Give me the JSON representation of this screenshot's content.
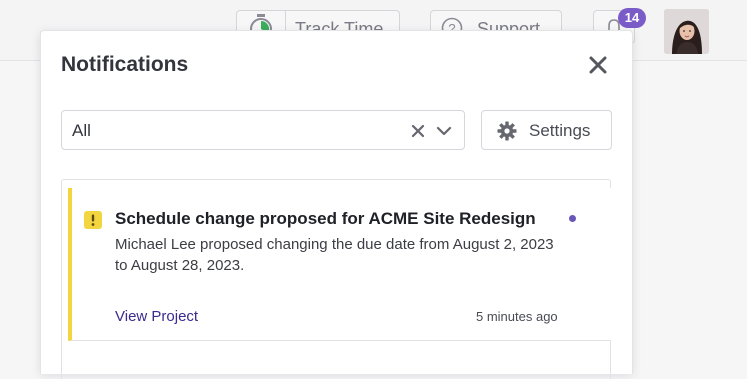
{
  "topbar": {
    "track_time_label": "Track Time",
    "support_label": "Support",
    "notification_count": "14",
    "badge_color": "#7a5bc8"
  },
  "panel": {
    "title": "Notifications",
    "filter": {
      "value": "All"
    },
    "settings_label": "Settings"
  },
  "notifications": [
    {
      "title": "Schedule change proposed for ACME Site Redesign",
      "body": "Michael Lee proposed changing the due date from August 2, 2023 to August 28, 2023.",
      "link_label": "View Project",
      "time": "5 minutes ago",
      "unread": true,
      "accent_color": "#f3d540",
      "icon": "warning-icon"
    }
  ]
}
